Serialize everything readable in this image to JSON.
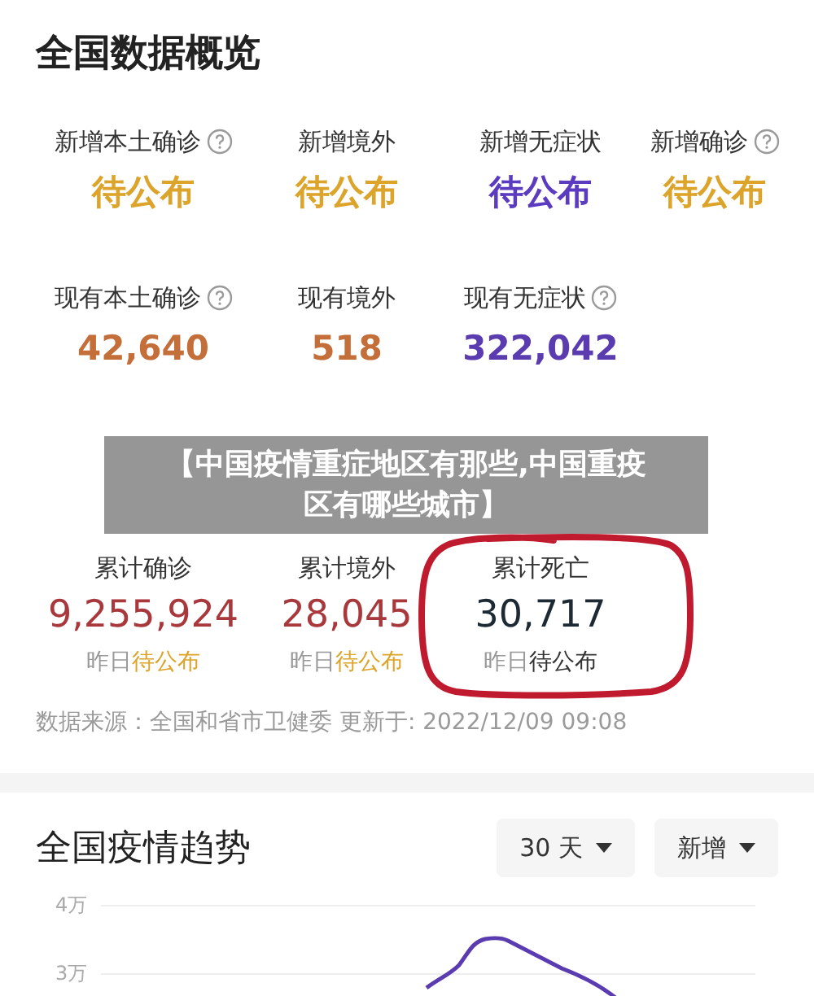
{
  "overview": {
    "title": "全国数据概览",
    "new_stats": [
      {
        "label": "新增本土确诊",
        "help": true,
        "value": "待公布",
        "color": "#dca42a"
      },
      {
        "label": "新增境外",
        "help": false,
        "value": "待公布",
        "color": "#dca42a"
      },
      {
        "label": "新增无症状",
        "help": false,
        "value": "待公布",
        "color": "#5b3cc0"
      },
      {
        "label": "新增确诊",
        "help": true,
        "value": "待公布",
        "color": "#dca42a"
      }
    ],
    "current_stats": [
      {
        "label": "现有本土确诊",
        "help": true,
        "value": "42,640",
        "color": "#c46e3a"
      },
      {
        "label": "现有境外",
        "help": false,
        "value": "518",
        "color": "#c46e3a"
      },
      {
        "label": "现有无症状",
        "help": true,
        "value": "322,042",
        "color": "#5b3cb0"
      }
    ],
    "total_stats": [
      {
        "label": "累计确诊",
        "value": "9,255,924",
        "color": "#a8383c",
        "sub": {
          "label": "昨日",
          "value": "待公布",
          "color": "#dca42a"
        }
      },
      {
        "label": "累计境外",
        "value": "28,045",
        "color": "#a8383c",
        "sub": {
          "label": "昨日",
          "value": "待公布",
          "color": "#dca42a"
        }
      },
      {
        "label": "累计死亡",
        "value": "30,717",
        "color": "#1d2a33",
        "sub": {
          "label": "昨日",
          "value": "待公布",
          "color": "#333333"
        }
      }
    ],
    "source": "数据来源：全国和省市卫健委 更新于: 2022/12/09 09:08"
  },
  "banner": "【中国疫情重症地区有那些,中国重疫区有哪些城市】",
  "trend": {
    "title": "全国疫情趋势",
    "range_button": "30 天",
    "type_button": "新增",
    "y_labels": [
      "4万",
      "3万"
    ]
  }
}
